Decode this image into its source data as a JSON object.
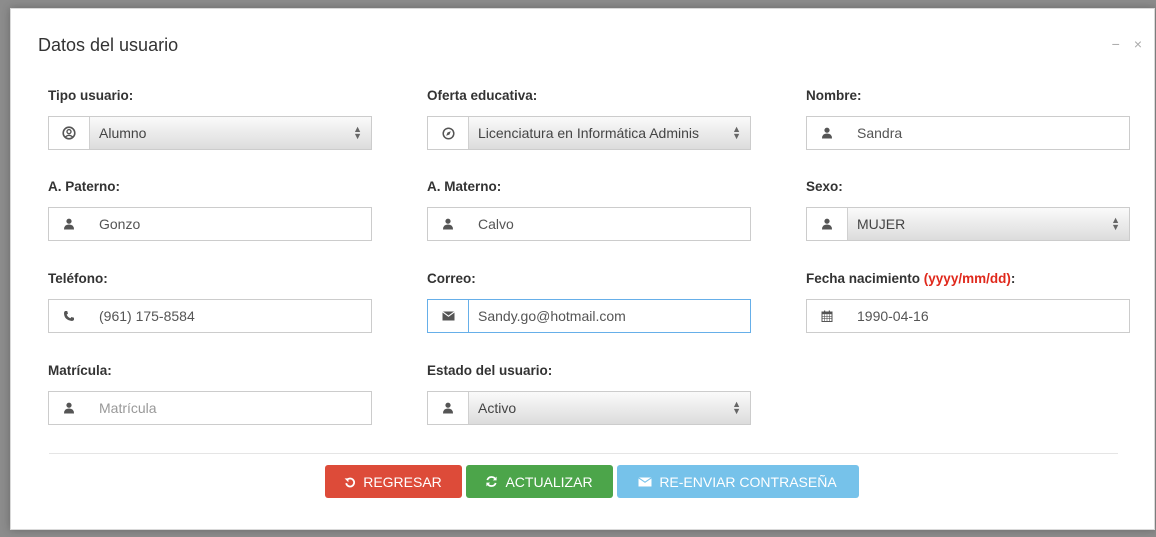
{
  "modal": {
    "title": "Datos del usuario",
    "minimize_glyph": "−",
    "close_glyph": "×"
  },
  "fields": {
    "tipo_usuario": {
      "label": "Tipo usuario:",
      "value": "Alumno",
      "icon": "user-circle-icon"
    },
    "oferta_educativa": {
      "label": "Oferta educativa:",
      "value": "Licenciatura en Informática Adminis",
      "icon": "compass-icon"
    },
    "nombre": {
      "label": "Nombre:",
      "value": "Sandra",
      "icon": "user-icon"
    },
    "a_paterno": {
      "label": "A. Paterno:",
      "value": "Gonzo",
      "icon": "user-icon"
    },
    "a_materno": {
      "label": "A. Materno:",
      "value": "Calvo",
      "icon": "user-icon"
    },
    "sexo": {
      "label": "Sexo:",
      "value": "MUJER",
      "icon": "user-icon"
    },
    "telefono": {
      "label": "Teléfono:",
      "value": "(961) 175-8584",
      "icon": "phone-icon"
    },
    "correo": {
      "label": "Correo:",
      "value": "Sandy.go@hotmail.com",
      "icon": "envelope-icon"
    },
    "fecha_nacimiento": {
      "label": "Fecha nacimiento ",
      "hint": "(yyyy/mm/dd)",
      "label_suffix": ":",
      "value": "1990-04-16",
      "icon": "calendar-icon"
    },
    "matricula": {
      "label": "Matrícula:",
      "placeholder": "Matrícula",
      "value": "",
      "icon": "user-icon"
    },
    "estado_usuario": {
      "label": "Estado del usuario:",
      "value": "Activo",
      "icon": "user-icon"
    }
  },
  "buttons": {
    "regresar": "REGRESAR",
    "actualizar": "ACTUALIZAR",
    "reenviar": "RE-ENVIAR CONTRASEÑA"
  },
  "colors": {
    "danger": "#dd4b39",
    "success": "#4ca54a",
    "info": "#76c2ea",
    "hint": "#e0281b",
    "focus_border": "#66afe9"
  }
}
